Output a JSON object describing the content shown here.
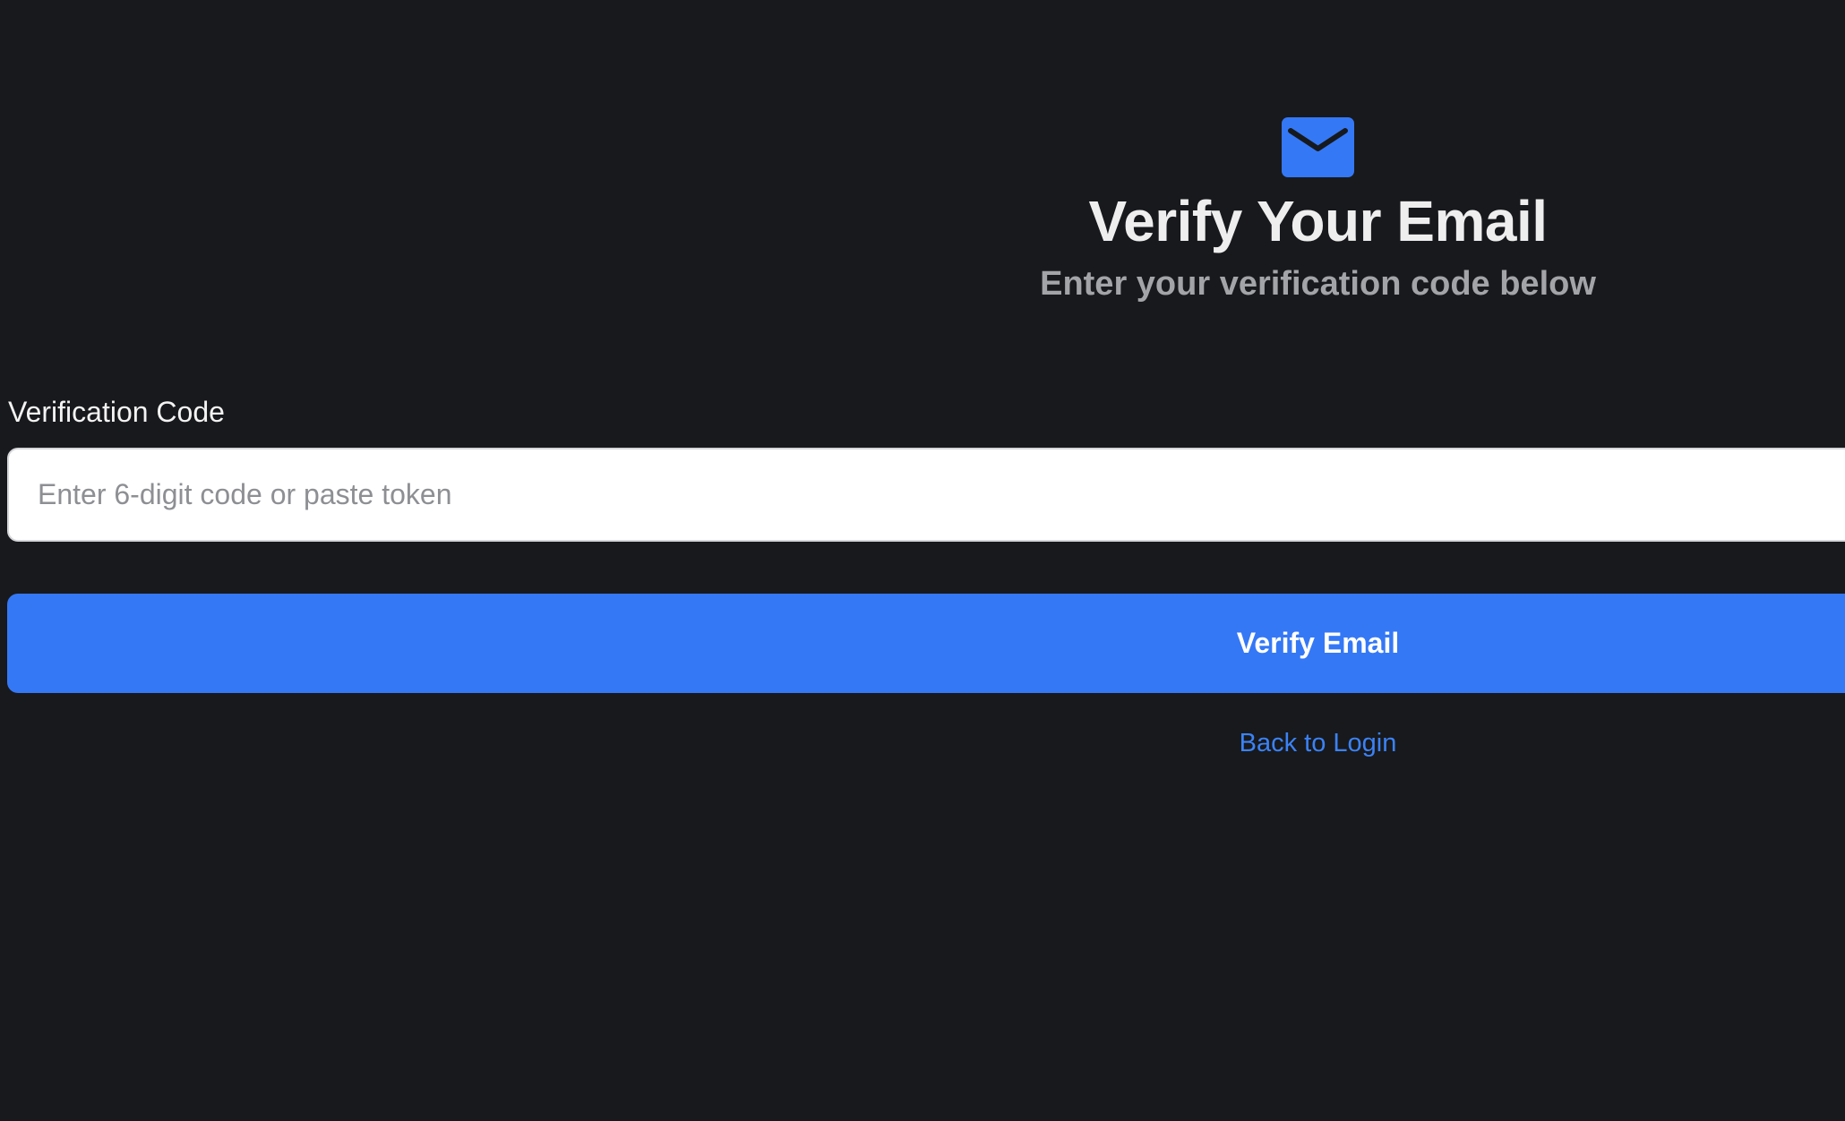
{
  "header": {
    "icon": "mail-icon",
    "title": "Verify Your Email",
    "subtitle": "Enter your verification code below"
  },
  "form": {
    "code_label": "Verification Code",
    "code_placeholder": "Enter 6-digit code or paste token",
    "code_value": "",
    "submit_label": "Verify Email"
  },
  "footer": {
    "back_link": "Back to Login"
  },
  "colors": {
    "background": "#18191c",
    "accent": "#3478f6",
    "title": "#eeeeef",
    "subtitle": "#a3a4a8",
    "link": "#3b82f6"
  }
}
